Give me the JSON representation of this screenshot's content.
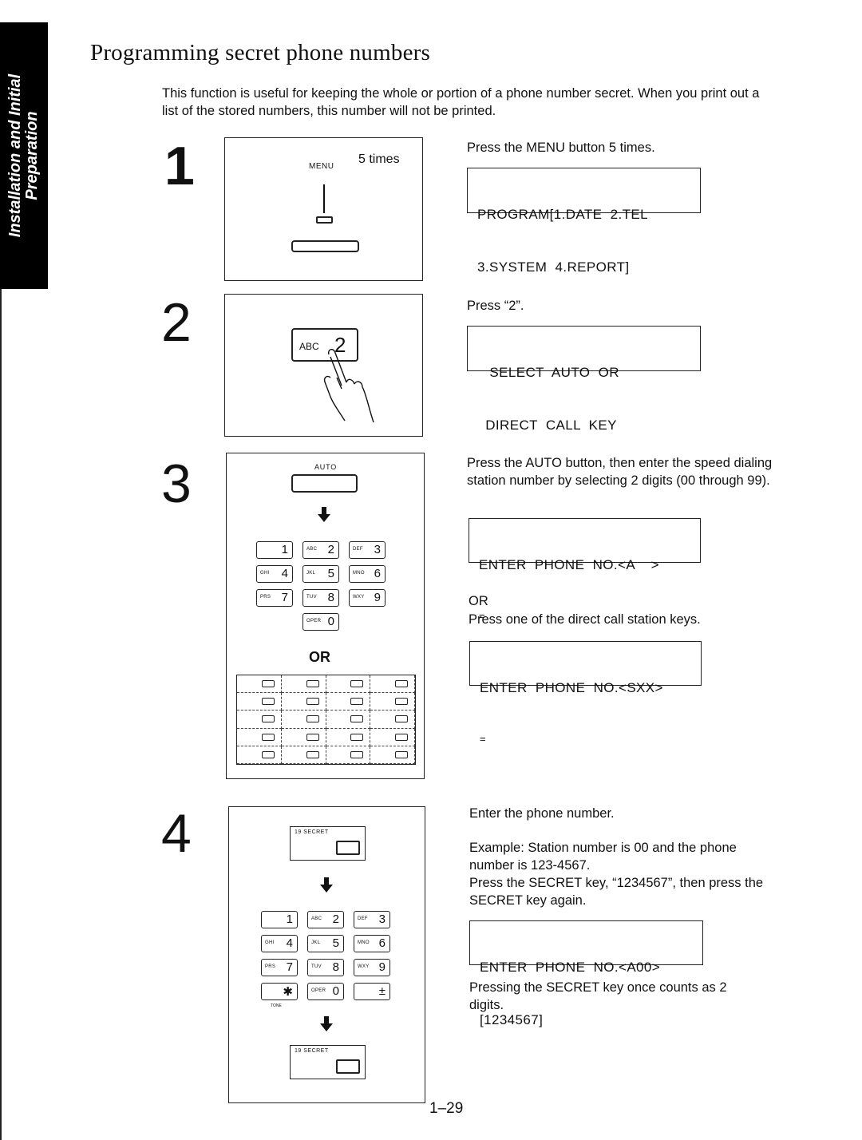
{
  "sidebar": {
    "section_line1": "Installation and Initial",
    "section_line2": "Preparation"
  },
  "page": {
    "title": "Programming secret phone numbers",
    "intro": "This function is useful for keeping the whole or portion of a phone number secret. When you print out a list of the stored numbers, this number will not be printed.",
    "page_number": "1–29"
  },
  "steps": [
    {
      "number": "1",
      "illustration": {
        "button_label": "MENU",
        "count_label": "5 times"
      },
      "instruction": "Press the MENU button 5 times.",
      "display": {
        "line1": "PROGRAM[1.DATE  2.TEL",
        "line2": "3.SYSTEM  4.REPORT]"
      }
    },
    {
      "number": "2",
      "illustration": {
        "key_letters": "ABC",
        "key_digit": "2"
      },
      "instruction": "Press “2”.",
      "display": {
        "line1": "   SELECT  AUTO  OR",
        "line2": "  DIRECT  CALL  KEY"
      }
    },
    {
      "number": "3",
      "illustration": {
        "button_label": "AUTO",
        "keypad": [
          {
            "letters": "",
            "digit": "1"
          },
          {
            "letters": "ABC",
            "digit": "2"
          },
          {
            "letters": "DEF",
            "digit": "3"
          },
          {
            "letters": "GHI",
            "digit": "4"
          },
          {
            "letters": "JKL",
            "digit": "5"
          },
          {
            "letters": "MNO",
            "digit": "6"
          },
          {
            "letters": "PRS",
            "digit": "7"
          },
          {
            "letters": "TUV",
            "digit": "8"
          },
          {
            "letters": "WXY",
            "digit": "9"
          },
          {
            "letters": "OPER",
            "digit": "0"
          }
        ],
        "or_label": "OR",
        "direct_call_grid": {
          "rows": 5,
          "cols": 4
        }
      },
      "instruction": "Press the AUTO button, then enter the speed dialing station number by selecting 2 digits (00 through 99).",
      "display": {
        "line1": "ENTER  PHONE  NO.<A    >",
        "line2": "="
      },
      "alt_or": "OR",
      "alt_instruction": "Press one of the direct call station keys.",
      "alt_display": {
        "line1": "ENTER  PHONE  NO.<SXX>",
        "line2": "="
      }
    },
    {
      "number": "4",
      "illustration": {
        "secret_key_label": "19  SECRET",
        "keypad": [
          {
            "letters": "",
            "digit": "1"
          },
          {
            "letters": "ABC",
            "digit": "2"
          },
          {
            "letters": "DEF",
            "digit": "3"
          },
          {
            "letters": "GHI",
            "digit": "4"
          },
          {
            "letters": "JKL",
            "digit": "5"
          },
          {
            "letters": "MNO",
            "digit": "6"
          },
          {
            "letters": "PRS",
            "digit": "7"
          },
          {
            "letters": "TUV",
            "digit": "8"
          },
          {
            "letters": "WXY",
            "digit": "9"
          },
          {
            "letters": "",
            "digit": "✱"
          },
          {
            "letters": "OPER",
            "digit": "0"
          },
          {
            "letters": "",
            "digit": "±"
          }
        ],
        "star_sublabel": "TONE"
      },
      "instruction": "Enter the phone number.",
      "example_line1": "Example:  Station number is 00 and the phone number is 123-4567.",
      "example_line2": "Press the SECRET key, “1234567”, then press the SECRET key again.",
      "display": {
        "line1": "ENTER  PHONE  NO.<A00>",
        "line2": "[1234567]"
      },
      "note": "Pressing the SECRET key once counts as 2 digits."
    }
  ]
}
